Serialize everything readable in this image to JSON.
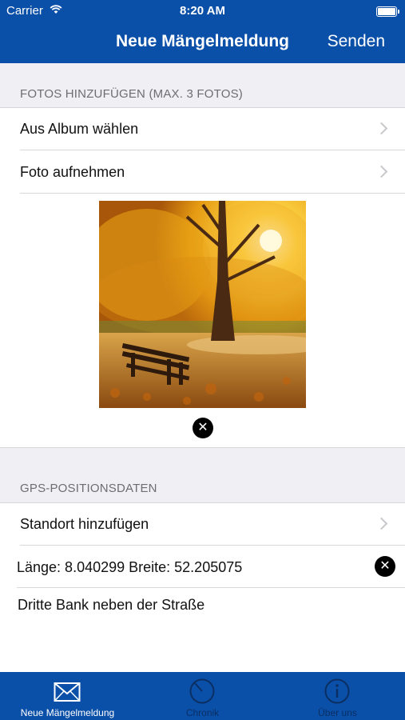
{
  "status_bar": {
    "carrier": "Carrier",
    "time": "8:20 AM"
  },
  "nav": {
    "title": "Neue Mängelmeldung",
    "action": "Senden"
  },
  "photos": {
    "header": "FOTOS HINZUFÜGEN (MAX. 3 FOTOS)",
    "rows": [
      {
        "label": "Aus Album wählen"
      },
      {
        "label": "Foto aufnehmen"
      }
    ],
    "remove_icon": "close-icon"
  },
  "gps": {
    "header": "GPS-POSITIONSDATEN",
    "add_location": "Standort hinzufügen",
    "coordinates": "Länge: 8.040299 Breite: 52.205075",
    "note": "Dritte Bank neben der Straße"
  },
  "tabbar": {
    "tabs": [
      {
        "label": "Neue Mängelmeldung",
        "icon": "envelope-icon",
        "active": true
      },
      {
        "label": "Chronik",
        "icon": "clock-icon",
        "active": false
      },
      {
        "label": "Über uns",
        "icon": "info-icon",
        "active": false
      }
    ]
  },
  "colors": {
    "brand": "#0a4fa8",
    "grouped_background": "#efeff4"
  }
}
